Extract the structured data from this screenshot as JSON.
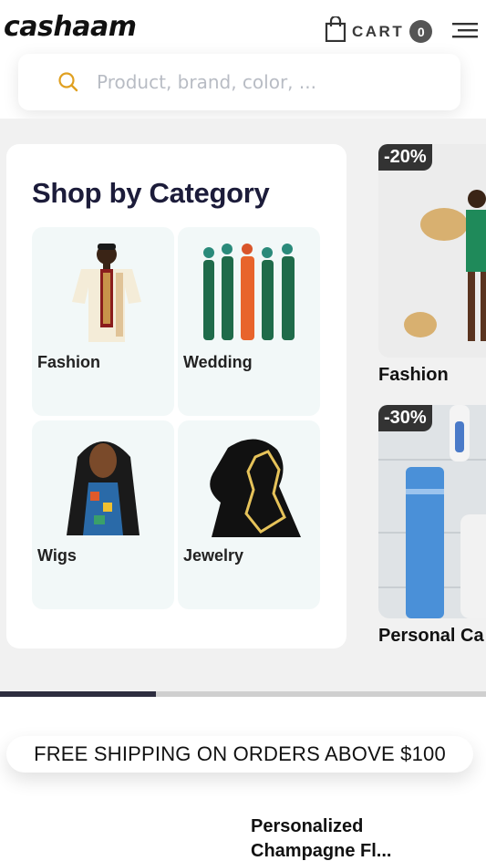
{
  "header": {
    "logo": "cashaam",
    "cart_label": "CART",
    "cart_count": "0"
  },
  "search": {
    "placeholder": "Product, brand, color, ..."
  },
  "categories": {
    "title": "Shop by Category",
    "items": [
      {
        "label": "Fashion"
      },
      {
        "label": "Wedding"
      },
      {
        "label": "Wigs"
      },
      {
        "label": "Jewelry"
      }
    ]
  },
  "deals": [
    {
      "discount": "-20%",
      "label": "Fashion"
    },
    {
      "discount": "-30%",
      "label": "Personal Ca"
    }
  ],
  "carousel": {
    "progress": 0.32
  },
  "banner": {
    "text": "FREE SHIPPING ON ORDERS ABOVE $100"
  },
  "product": {
    "name_line1": "Personalized",
    "name_line2": "Champagne Fl..."
  },
  "colors": {
    "accent": "#e0a020",
    "title": "#1c1c3a",
    "badge": "#555555"
  }
}
